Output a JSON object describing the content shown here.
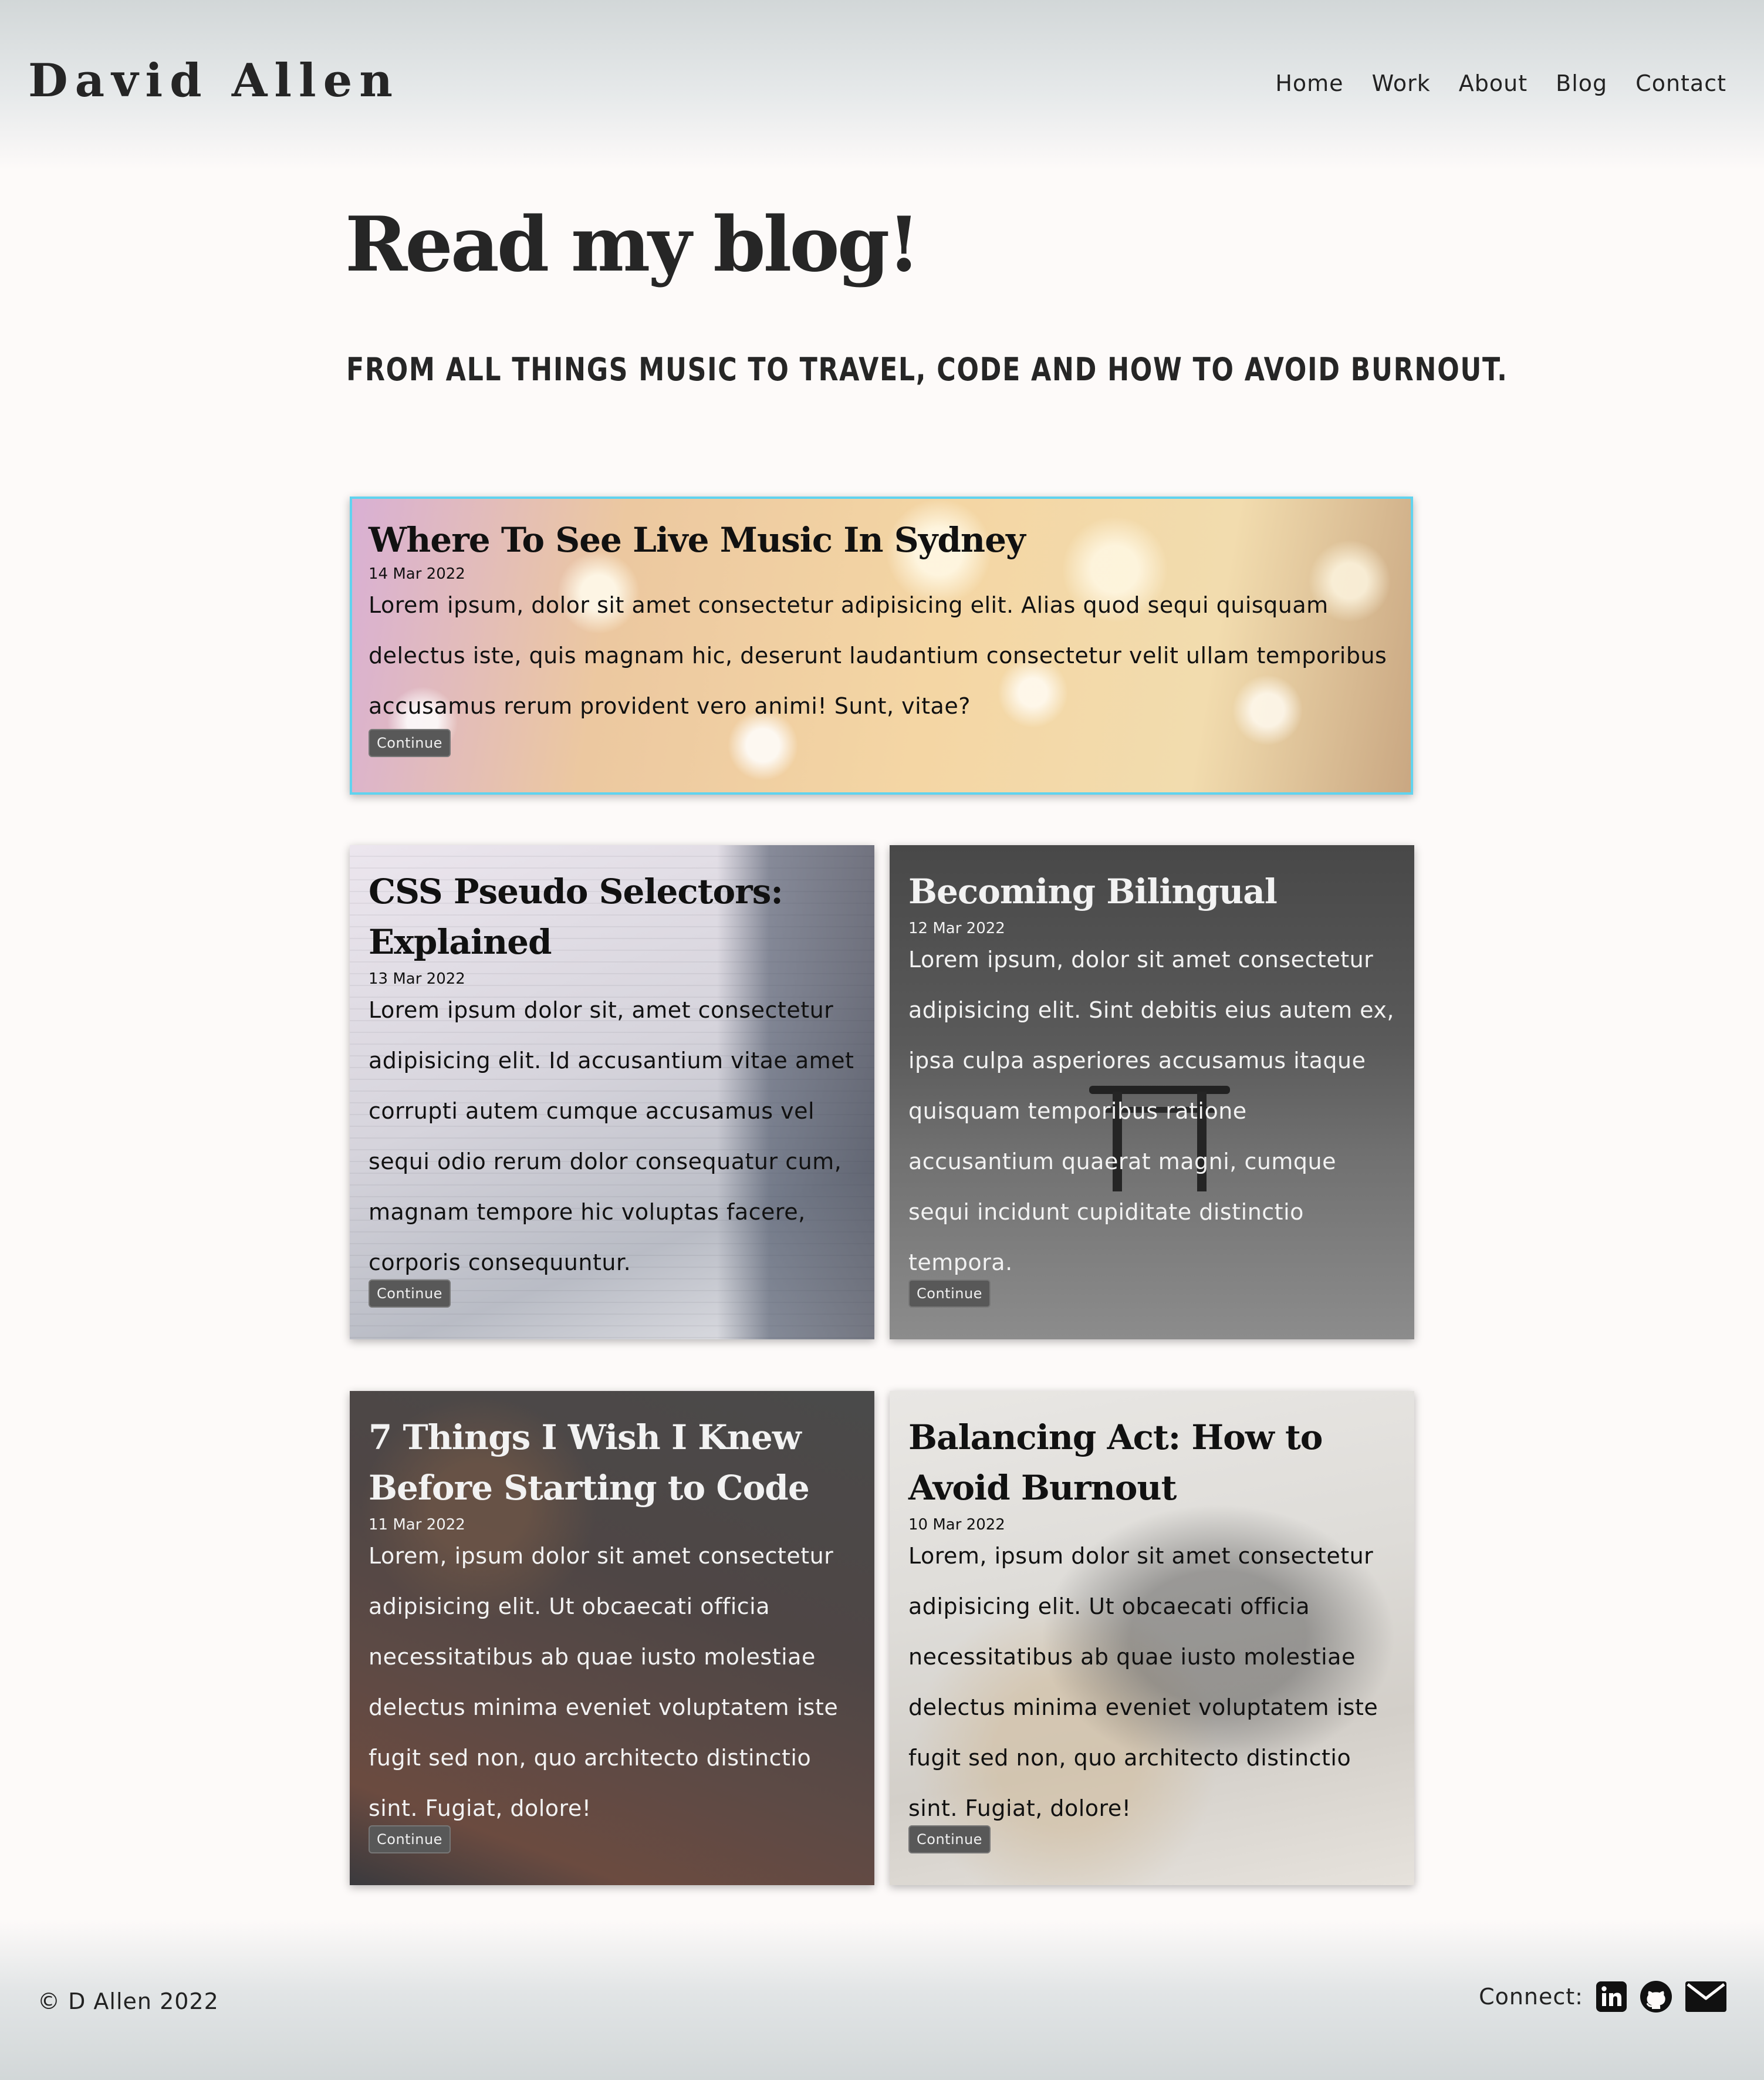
{
  "header": {
    "logo": "David Allen",
    "nav": [
      "Home",
      "Work",
      "About",
      "Blog",
      "Contact"
    ]
  },
  "intro": {
    "title": "Read my blog!",
    "subtitle": "FROM ALL THINGS MUSIC TO TRAVEL, CODE AND HOW TO AVOID BURNOUT."
  },
  "posts": [
    {
      "title": "Where To See Live Music In Sydney",
      "date": "14 Mar 2022",
      "excerpt": "Lorem ipsum, dolor sit amet consectetur adipisicing elit. Alias quod sequi quisquam delectus iste, quis magnam hic, deserunt laudantium consectetur velit ullam temporibus accusamus rerum provident vero animi! Sunt, vitae?",
      "button": "Continue"
    },
    {
      "title": "CSS Pseudo Selectors: Explained",
      "date": "13 Mar 2022",
      "excerpt": "Lorem ipsum dolor sit, amet consectetur adipisicing elit. Id accusantium vitae amet corrupti autem cumque accusamus vel sequi odio rerum dolor consequatur cum, magnam tempore hic voluptas facere, corporis consequuntur.",
      "button": "Continue"
    },
    {
      "title": "Becoming Bilingual",
      "date": "12 Mar 2022",
      "excerpt": "Lorem ipsum, dolor sit amet consectetur adipisicing elit. Sint debitis eius autem ex, ipsa culpa asperiores accusamus itaque quisquam temporibus ratione accusantium quaerat magni, cumque sequi incidunt cupiditate distinctio tempora.",
      "button": "Continue"
    },
    {
      "title": "7 Things I Wish I Knew Before Starting to Code",
      "date": "11 Mar 2022",
      "excerpt": "Lorem, ipsum dolor sit amet consectetur adipisicing elit. Ut obcaecati officia necessitatibus ab quae iusto molestiae delectus minima eveniet voluptatem iste fugit sed non, quo architecto distinctio sint. Fugiat, dolore!",
      "button": "Continue"
    },
    {
      "title": "Balancing Act: How to Avoid Burnout",
      "date": "10 Mar 2022",
      "excerpt": "Lorem, ipsum dolor sit amet consectetur adipisicing elit. Ut obcaecati officia necessitatibus ab quae iusto molestiae delectus minima eveniet voluptatem iste fugit sed non, quo architecto distinctio sint. Fugiat, dolore!",
      "button": "Continue"
    }
  ],
  "footer": {
    "copyright": "© D Allen 2022",
    "connect_label": "Connect:",
    "icons": [
      "linkedin-icon",
      "github-icon",
      "email-icon"
    ]
  },
  "colors": {
    "highlight_border": "#60d3ef",
    "button_bg": "#585858",
    "header_bg": "#d2d7d8",
    "page_bg": "#fdfaf9"
  }
}
